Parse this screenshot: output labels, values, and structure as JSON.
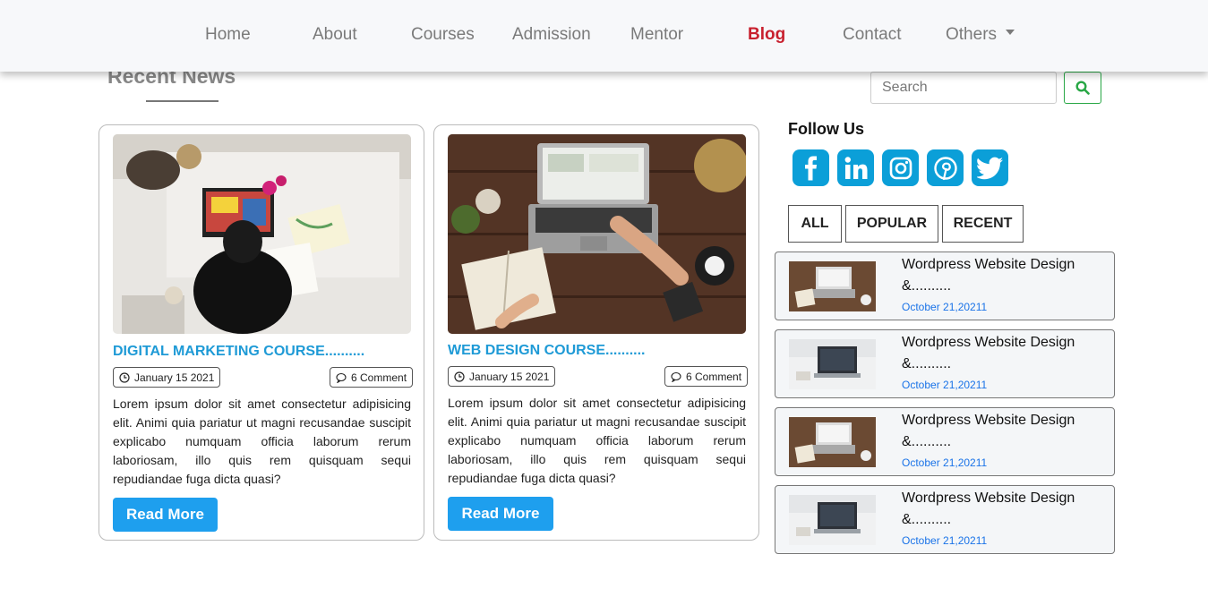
{
  "nav": {
    "items": [
      {
        "label": "Home"
      },
      {
        "label": "About"
      },
      {
        "label": "Courses"
      },
      {
        "label": "Admission"
      },
      {
        "label": "Mentor"
      },
      {
        "label": "Blog"
      },
      {
        "label": "Contact"
      },
      {
        "label": "Others"
      }
    ],
    "active": "Blog",
    "active_color": "#c8202e"
  },
  "section": {
    "title": "Recent News"
  },
  "search": {
    "placeholder": "Search",
    "button_icon": "search-icon",
    "button_color": "#28a745"
  },
  "cards": [
    {
      "title": "DIGITAL MARKETING COURSE..........",
      "date": "January 15 2021",
      "comments": "6 Comment",
      "text": "Lorem ipsum dolor sit amet consectetur adipisicing elit. Animi quia pariatur ut magni recusandae suscipit explicabo numquam officia laborum rerum laboriosam, illo quis rem quisquam sequi repudiandae fuga dicta quasi?",
      "button": "Read More"
    },
    {
      "title": "WEB DESIGN COURSE..........",
      "date": "January 15 2021",
      "comments": "6 Comment",
      "text": "Lorem ipsum dolor sit amet consectetur adipisicing elit. Animi quia pariatur ut magni recusandae suscipit explicabo numquam officia laborum rerum laboriosam, illo quis rem quisquam sequi repudiandae fuga dicta quasi?",
      "button": "Read More"
    }
  ],
  "sidebar": {
    "follow_title": "Follow Us",
    "social_icons": [
      "facebook-icon",
      "linkedin-icon",
      "instagram-icon",
      "pinterest-icon",
      "twitter-icon"
    ],
    "social_color": "#0b9fd8",
    "filters": [
      {
        "label": "ALL"
      },
      {
        "label": "POPULAR"
      },
      {
        "label": "RECENT"
      }
    ],
    "posts": [
      {
        "title": "Wordpress Website Design &..........",
        "date": "October 21,20211"
      },
      {
        "title": "Wordpress Website Design &..........",
        "date": "October 21,20211"
      },
      {
        "title": "Wordpress Website Design &..........",
        "date": "October 21,20211"
      },
      {
        "title": "Wordpress Website Design &..........",
        "date": "October 21,20211"
      }
    ]
  }
}
